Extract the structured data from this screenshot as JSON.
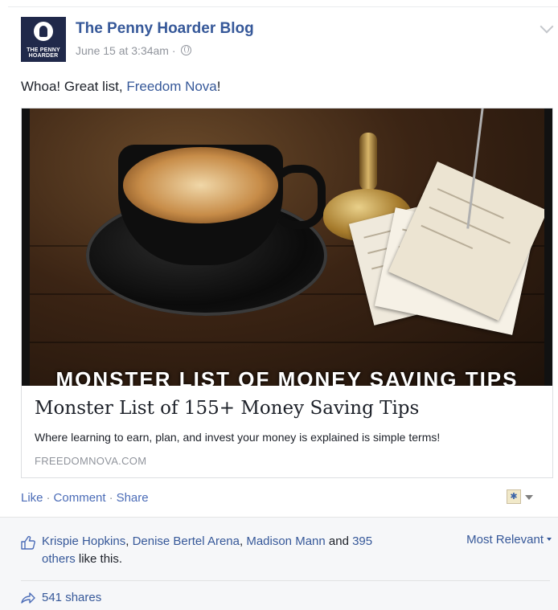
{
  "post": {
    "page_name": "The Penny Hoarder Blog",
    "avatar_text": "THE PENNY HOARDER",
    "timestamp": "June 15 at 3:34am",
    "dot": " · ",
    "text_prefix": "Whoa! Great list, ",
    "text_mention": "Freedom Nova",
    "text_suffix": "!"
  },
  "link_preview": {
    "image_overlay": "MONSTER LIST OF MONEY SAVING TIPS",
    "title": "Monster List of 155+ Money Saving Tips",
    "description": "Where learning to earn, plan, and invest your money is explained is simple terms!",
    "domain": "FREEDOMNOVA.COM"
  },
  "actions": {
    "like": "Like",
    "comment": "Comment",
    "share": "Share",
    "separator": "·"
  },
  "reactions": {
    "name1": "Krispie Hopkins",
    "sep1": ", ",
    "name2": "Denise Bertel Arena",
    "sep2": ", ",
    "name3": "Madison Mann",
    "and": " and ",
    "others": "395 others",
    "suffix": " like this.",
    "sort_label": "Most Relevant"
  },
  "shares": {
    "label": "541 shares"
  },
  "colors": {
    "link": "#365899",
    "action": "#4b6cb7",
    "muted": "#90949c",
    "ufi_background": "#f6f7f9"
  },
  "icons": [
    "globe-icon",
    "chevron-down-icon",
    "thumbs-up-icon",
    "share-arrow-icon",
    "caret-down-icon"
  ]
}
